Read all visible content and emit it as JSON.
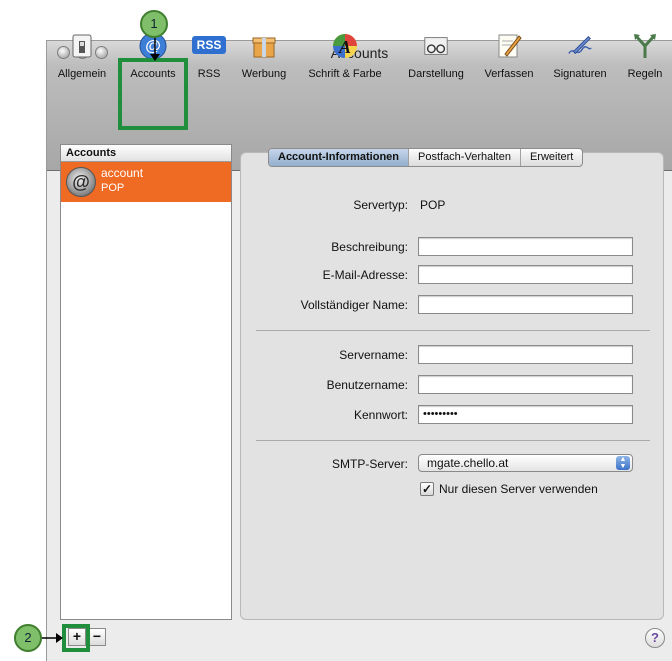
{
  "window": {
    "title": "Accounts"
  },
  "toolbar": {
    "items": [
      {
        "label": "Allgemein",
        "icon": "switch-icon"
      },
      {
        "label": "Accounts",
        "icon": "at-icon"
      },
      {
        "label": "RSS",
        "icon": "rss-icon",
        "icon_text": "RSS"
      },
      {
        "label": "Werbung",
        "icon": "gift-box-icon"
      },
      {
        "label": "Schrift & Farbe",
        "icon": "font-color-icon",
        "icon_text": "A"
      },
      {
        "label": "Darstellung",
        "icon": "glasses-icon"
      },
      {
        "label": "Verfassen",
        "icon": "pencil-note-icon"
      },
      {
        "label": "Signaturen",
        "icon": "pen-signature-icon"
      },
      {
        "label": "Regeln",
        "icon": "rules-icon"
      }
    ]
  },
  "sidebar": {
    "header": "Accounts",
    "account": {
      "name": "account",
      "type": "POP"
    }
  },
  "tabs": [
    "Account-Informationen",
    "Postfach-Verhalten",
    "Erweitert"
  ],
  "form": {
    "servertyp_label": "Servertyp:",
    "servertyp_value": "POP",
    "beschreibung_label": "Beschreibung:",
    "email_label": "E-Mail-Adresse:",
    "name_label": "Vollständiger Name:",
    "servername_label": "Servername:",
    "benutzername_label": "Benutzername:",
    "kennwort_label": "Kennwort:",
    "kennwort_value": "•••••••••",
    "smtp_label": "SMTP-Server:",
    "smtp_value": "mgate.chello.at",
    "checkbox_label": "Nur diesen Server verwenden",
    "checkbox_checked": true
  },
  "bottom": {
    "add": "+",
    "remove": "−",
    "help": "?"
  },
  "callouts": {
    "one": "1",
    "two": "2"
  },
  "colors": {
    "selection": "#ef6a23",
    "highlight": "#1f8f3b",
    "callout": "#7fbf6a"
  }
}
